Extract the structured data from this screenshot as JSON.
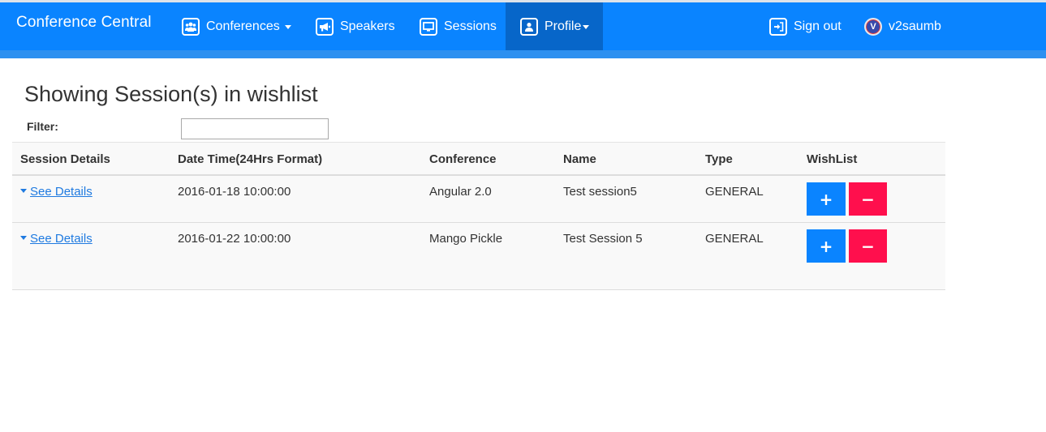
{
  "navbar": {
    "brand": "Conference Central",
    "conferences": "Conferences",
    "speakers": "Speakers",
    "sessions": "Sessions",
    "profile": "Profile",
    "sign_out": "Sign out",
    "username": "v2saumb",
    "avatar_letter": "V"
  },
  "page": {
    "title": "Showing Session(s) in wishlist",
    "filter_label": "Filter:",
    "filter_value": ""
  },
  "table": {
    "headers": [
      "Session Details",
      "Date Time(24Hrs Format)",
      "Conference",
      "Name",
      "Type",
      "WishList"
    ],
    "rows": [
      {
        "details": "See Details",
        "datetime": "2016-01-18 10:00:00",
        "conference": "Angular 2.0",
        "name": "Test session5",
        "type": "GENERAL"
      },
      {
        "details": "See Details",
        "datetime": "2016-01-22 10:00:00",
        "conference": "Mango Pickle",
        "name": "Test Session 5",
        "type": "GENERAL"
      }
    ],
    "add_symbol": "+",
    "remove_symbol": "−"
  },
  "colors": {
    "navbar": "#0a84ff",
    "navbar_active": "#0766c9",
    "add_button": "#0a84ff",
    "remove_button": "#ff0f4d",
    "link": "#1f7ae0"
  }
}
